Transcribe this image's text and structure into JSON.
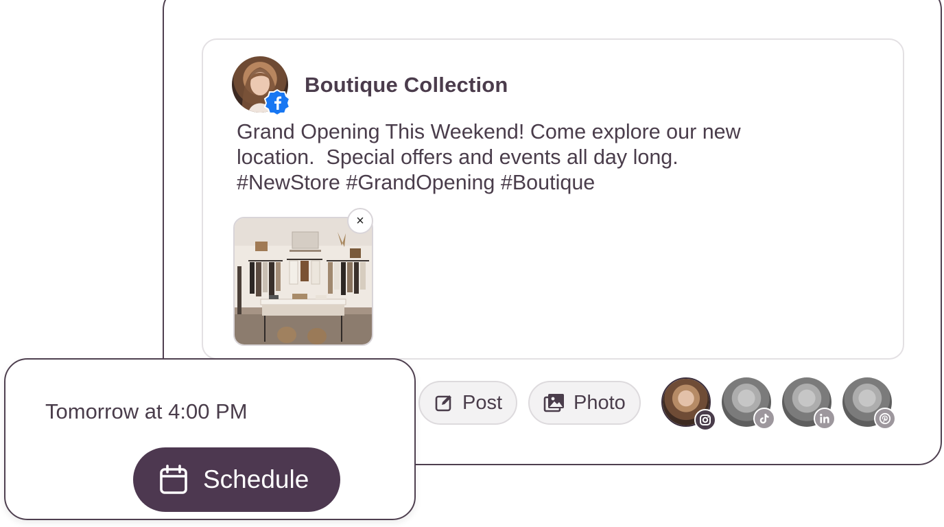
{
  "post": {
    "account_name": "Boutique Collection",
    "network_icon": "facebook-icon",
    "text_lines": [
      "Grand Opening This Weekend! Come explore our new",
      "location.  Special offers and events all day long.",
      "#NewStore #GrandOpening #Boutique"
    ],
    "attachment_close": "×"
  },
  "toolbar": {
    "post_label": "Post",
    "photo_label": "Photo"
  },
  "accounts": [
    {
      "network": "instagram-icon",
      "selected": true
    },
    {
      "network": "tiktok-icon",
      "selected": false
    },
    {
      "network": "linkedin-icon",
      "selected": false
    },
    {
      "network": "pinterest-icon",
      "selected": false
    }
  ],
  "schedule": {
    "time_text": "Tomorrow at 4:00 PM",
    "button_label": "Schedule"
  },
  "colors": {
    "accent": "#4d3850",
    "border": "#4e3f4f",
    "facebook": "#1877f2"
  }
}
